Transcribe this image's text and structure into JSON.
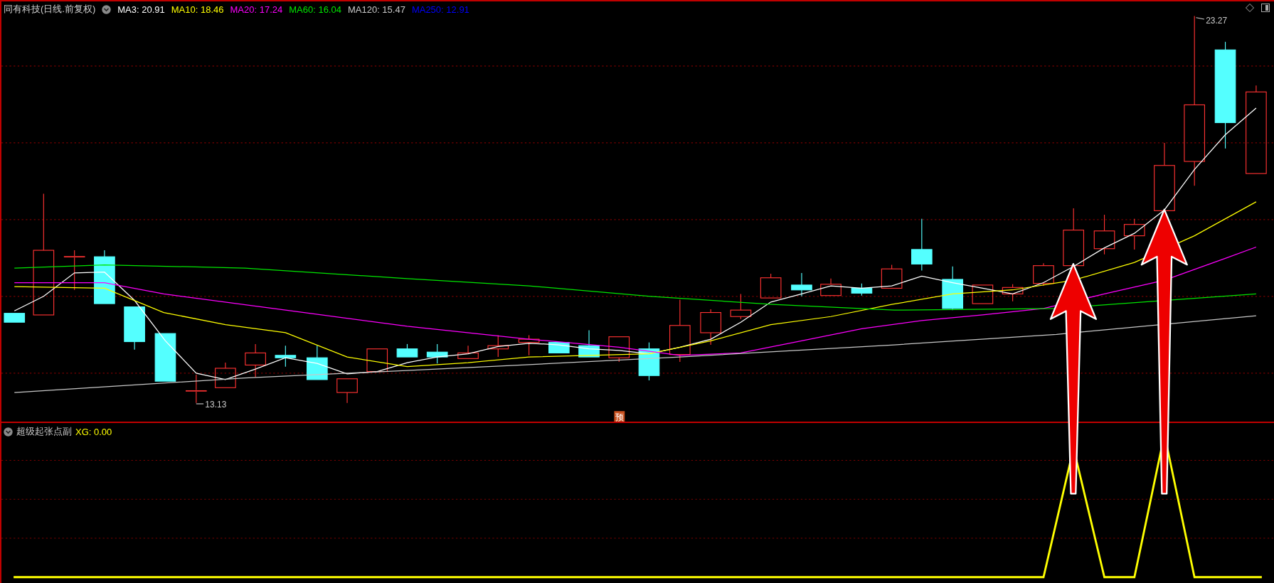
{
  "chart": {
    "title": "同有科技(日线.前复权)",
    "ma_legend": [
      {
        "text": "MA3: 20.91",
        "color": "#ffffff"
      },
      {
        "text": "MA10: 18.46",
        "color": "#ffff00"
      },
      {
        "text": "MA20: 17.24",
        "color": "#ff00ff"
      },
      {
        "text": "MA60: 16.04",
        "color": "#00e600"
      },
      {
        "text": "MA120: 15.47",
        "color": "#c8c8c8"
      },
      {
        "text": "MA250: 12.91",
        "color": "#0000ff"
      }
    ],
    "high_label": "23.27",
    "low_label": "13.13",
    "badge": "预"
  },
  "indicator": {
    "title": "超级起张点副",
    "reading": "XG: 0.00"
  }
}
